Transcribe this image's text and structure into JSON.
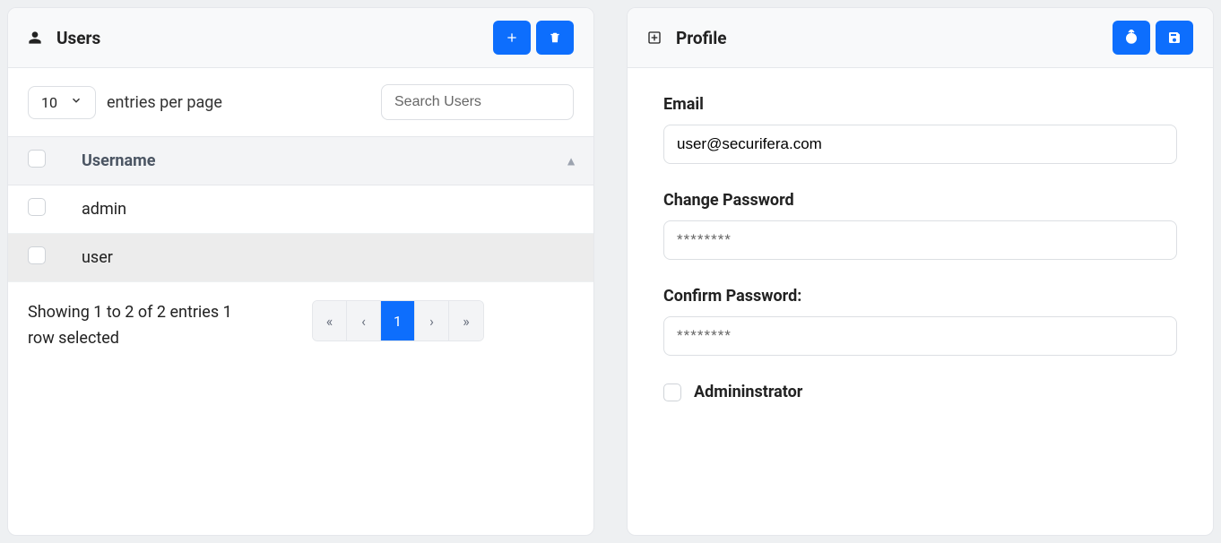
{
  "users_panel": {
    "title": "Users",
    "entries_select_value": "10",
    "entries_label": "entries per page",
    "search_placeholder": "Search Users",
    "column_header": "Username",
    "rows": [
      {
        "username": "admin",
        "selected": false
      },
      {
        "username": "user",
        "selected": true
      }
    ],
    "footer_text": "Showing 1 to 2 of 2 entries   1 row selected",
    "pagination": {
      "first": "«",
      "prev": "‹",
      "current": "1",
      "next": "›",
      "last": "»"
    }
  },
  "profile_panel": {
    "title": "Profile",
    "email_label": "Email",
    "email_value": "user@securifera.com",
    "password_label": "Change Password",
    "password_placeholder": "********",
    "confirm_label": "Confirm Password:",
    "confirm_placeholder": "********",
    "admin_label": "Admininstrator"
  }
}
